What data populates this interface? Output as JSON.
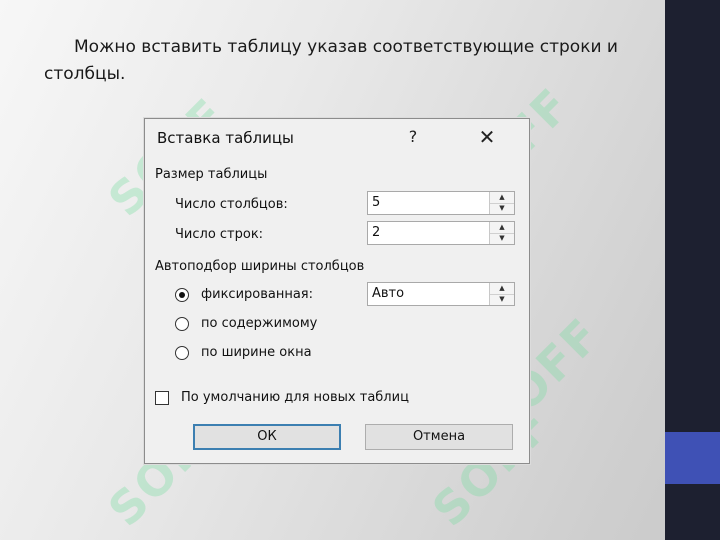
{
  "slide": {
    "text": "Можно вставить таблицу указав соответствующие строки и столбцы."
  },
  "watermark": {
    "text": "SOFF"
  },
  "colors": {
    "right_panel": "#1d2030",
    "accent": "#3f51b5"
  },
  "dialog": {
    "title": "Вставка таблицы",
    "help_label": "?",
    "close_label": "✕",
    "size_section": "Размер таблицы",
    "columns_label": "Число столбцов:",
    "columns_value": "5",
    "rows_label": "Число строк:",
    "rows_value": "2",
    "autofit_section": "Автоподбор ширины столбцов",
    "fixed_label": "фиксированная:",
    "fixed_value": "Авто",
    "content_label": "по содержимому",
    "window_label": "по ширине окна",
    "default_checkbox_label": "По умолчанию для новых таблиц",
    "ok_label": "ОК",
    "cancel_label": "Отмена",
    "selected_autofit": "fixed",
    "default_checked": false
  }
}
